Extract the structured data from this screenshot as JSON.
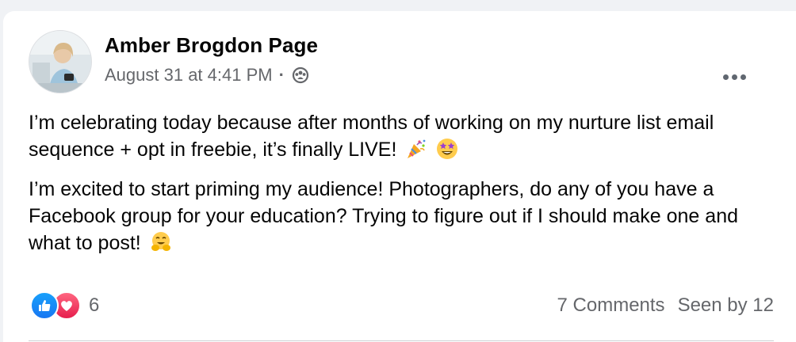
{
  "post": {
    "author": "Amber Brogdon Page",
    "timestamp": "August 31 at 4:41 PM",
    "separator": "·",
    "audience_icon": "group-icon",
    "paragraph1": "I’m celebrating today because after months of working on my nurture list email sequence + opt in freebie, it’s finally LIVE!",
    "paragraph1_emojis": [
      "party-popper-icon",
      "star-struck-icon"
    ],
    "paragraph2": "I’m excited to start priming my audience! Photographers, do any of you have a Facebook group for your education? Trying to figure out if I should make one and what to post!",
    "paragraph2_emojis": [
      "hugging-face-icon"
    ]
  },
  "footer": {
    "reaction_icons": [
      "like-icon",
      "love-icon"
    ],
    "reaction_count": "6",
    "comments": "7 Comments",
    "seen_by": "Seen by 12"
  },
  "colors": {
    "background": "#f0f2f5",
    "card": "#ffffff",
    "text_primary": "#050505",
    "text_secondary": "#65676b",
    "like_blue": "#1877f2",
    "love_red": "#e61e4d"
  }
}
